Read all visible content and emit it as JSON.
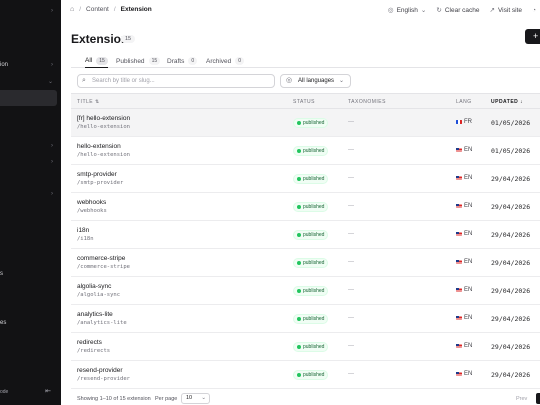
{
  "sidebar": {
    "items": [
      {
        "label": "",
        "chevron": "›"
      },
      {
        "label": "ion",
        "chevron": "›"
      },
      {
        "label": "",
        "chevron": "⌄"
      },
      {
        "label": "",
        "chevron": "›"
      },
      {
        "label": "",
        "chevron": "›"
      },
      {
        "label": "",
        "chevron": "›"
      },
      {
        "label": "s",
        "chevron": ""
      },
      {
        "label": "es",
        "chevron": ""
      }
    ],
    "footer_text": "ode"
  },
  "breadcrumb": {
    "home_icon": "home-icon",
    "items": [
      "Content",
      "Extension"
    ]
  },
  "topbar": {
    "language": "English",
    "clear_cache": "Clear cache",
    "visit_site": "Visit site"
  },
  "header": {
    "title": "Extension",
    "count": "15"
  },
  "tabs": [
    {
      "label": "All",
      "count": "15",
      "active": true
    },
    {
      "label": "Published",
      "count": "15",
      "active": false
    },
    {
      "label": "Drafts",
      "count": "0",
      "active": false
    },
    {
      "label": "Archived",
      "count": "0",
      "active": false
    }
  ],
  "filters": {
    "search_placeholder": "Search by title or slug...",
    "language_value": "All languages"
  },
  "table": {
    "columns": {
      "title": "TITLE ⇅",
      "status": "STATUS",
      "taxonomies": "TAXONOMIES",
      "lang": "LANG",
      "updated": "UPDATED ↓"
    },
    "rows": [
      {
        "title": "[fr] hello-extension",
        "slug": "/hello-extension",
        "status": "published",
        "taxonomies": "—",
        "lang": "FR",
        "flag": "fr",
        "updated": "01/05/2026",
        "highlight": true
      },
      {
        "title": "hello-extension",
        "slug": "/hello-extension",
        "status": "published",
        "taxonomies": "—",
        "lang": "EN",
        "flag": "en",
        "updated": "01/05/2026"
      },
      {
        "title": "smtp-provider",
        "slug": "/smtp-provider",
        "status": "published",
        "taxonomies": "—",
        "lang": "EN",
        "flag": "en",
        "updated": "29/04/2026"
      },
      {
        "title": "webhooks",
        "slug": "/webhooks",
        "status": "published",
        "taxonomies": "—",
        "lang": "EN",
        "flag": "en",
        "updated": "29/04/2026"
      },
      {
        "title": "i18n",
        "slug": "/i18n",
        "status": "published",
        "taxonomies": "—",
        "lang": "EN",
        "flag": "en",
        "updated": "29/04/2026"
      },
      {
        "title": "commerce-stripe",
        "slug": "/commerce-stripe",
        "status": "published",
        "taxonomies": "—",
        "lang": "EN",
        "flag": "en",
        "updated": "29/04/2026"
      },
      {
        "title": "algolia-sync",
        "slug": "/algolia-sync",
        "status": "published",
        "taxonomies": "—",
        "lang": "EN",
        "flag": "en",
        "updated": "29/04/2026"
      },
      {
        "title": "analytics-lite",
        "slug": "/analytics-lite",
        "status": "published",
        "taxonomies": "—",
        "lang": "EN",
        "flag": "en",
        "updated": "29/04/2026"
      },
      {
        "title": "redirects",
        "slug": "/redirects",
        "status": "published",
        "taxonomies": "—",
        "lang": "EN",
        "flag": "en",
        "updated": "29/04/2026"
      },
      {
        "title": "resend-provider",
        "slug": "/resend-provider",
        "status": "published",
        "taxonomies": "—",
        "lang": "EN",
        "flag": "en",
        "updated": "29/04/2026"
      }
    ]
  },
  "footer": {
    "info": "Showing 1–10 of 15 extension",
    "per_page_label": "Per page",
    "per_page_value": "10",
    "prev": "Prev"
  },
  "colors": {
    "sidebar_bg": "#121214",
    "accent": "#18181b",
    "published": "#22c55e"
  }
}
